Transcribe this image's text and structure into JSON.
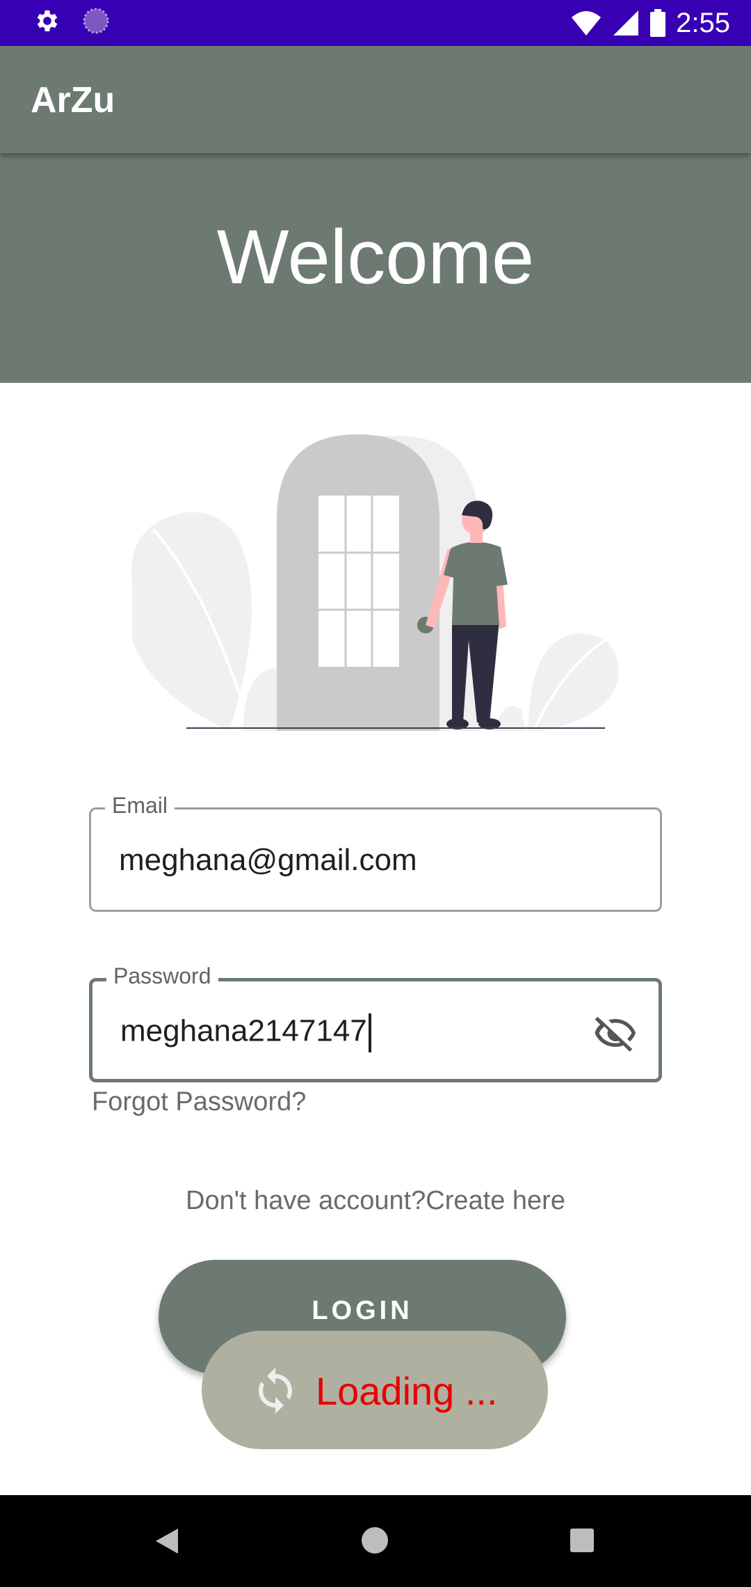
{
  "status_bar": {
    "time": "2:55"
  },
  "app_bar": {
    "title": "ArZu"
  },
  "banner": {
    "welcome_text": "Welcome"
  },
  "form": {
    "email": {
      "label": "Email",
      "value": "meghana@gmail.com"
    },
    "password": {
      "label": "Password",
      "value": "meghana2147147"
    },
    "forgot_password": "Forgot Password?",
    "signup_prompt": "Don't have account?Create here",
    "login_label": "LOGIN"
  },
  "loading": {
    "text": "Loading ..."
  },
  "colors": {
    "status_bar": "#3700b3",
    "primary": "#6d7a72",
    "loading_bg": "#b0b0a0",
    "loading_text": "#e60000"
  }
}
